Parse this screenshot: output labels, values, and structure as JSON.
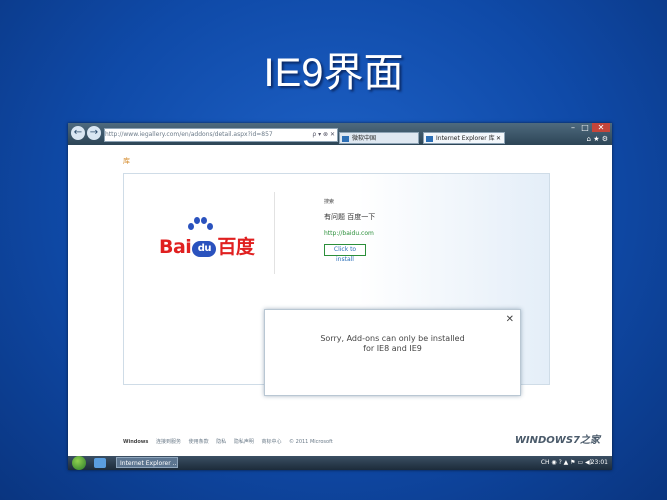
{
  "slide": {
    "title": "IE9界面"
  },
  "browser": {
    "address": "http://www.iegallery.com/en/addons/detail.aspx?id=857",
    "address_icons": "ρ ▾ ⊗ ✕",
    "tab1_label": "微软中国",
    "tab2_label": "Internet Explorer 库",
    "tab_close": "✕",
    "back": "←",
    "forward": "→",
    "win_min": "–",
    "win_max": "□",
    "win_close": "✕",
    "right_icons": "⌂ ★ ⚙"
  },
  "page": {
    "crumb": "库",
    "logo": {
      "left": "Bai",
      "mid": "du",
      "right": "百度"
    },
    "addon_kind": "搜索",
    "addon_desc": "有问题 百度一下",
    "addon_link": "http://baidu.com",
    "install_button": "Click to install",
    "dialog": {
      "close": "✕",
      "line1": "Sorry, Add-ons can only be installed",
      "line2": "for IE8 and IE9"
    },
    "footer": {
      "windows": "Windows",
      "links": [
        "连接到服务",
        "使用条款",
        "隐私",
        "隐私声明",
        "商标中心"
      ],
      "copyright": "© 2011 Microsoft"
    },
    "brand": "WINDOWS7之家"
  },
  "taskbar": {
    "task_label": "Internet Explorer ...",
    "tray": "CH ◉ ? ▲ ⚑ ▭ ◀)",
    "clock": "23:01"
  }
}
